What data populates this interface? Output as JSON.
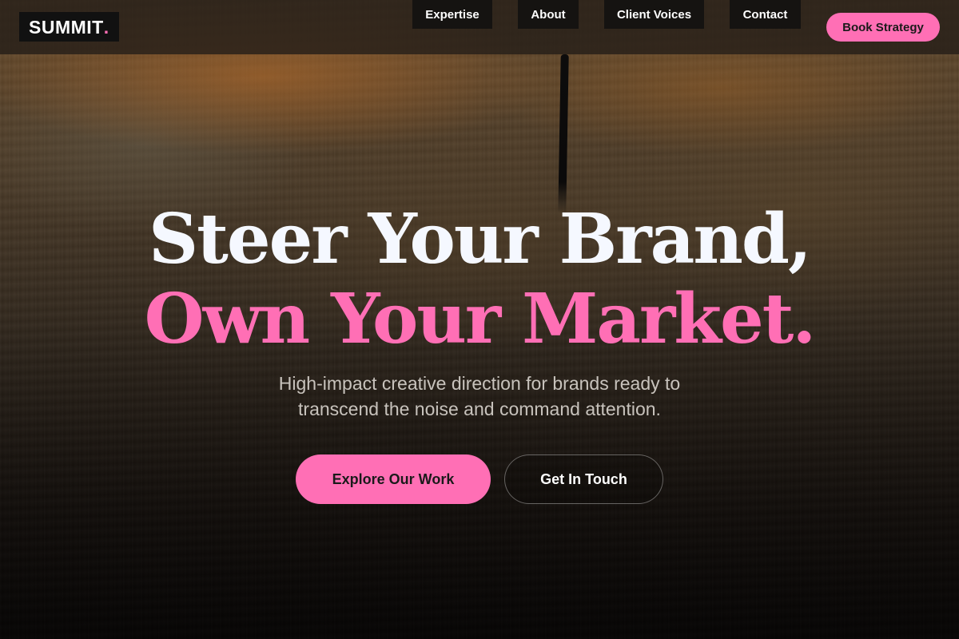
{
  "header": {
    "logo_text": "SUMMIT",
    "logo_dot": ".",
    "nav": [
      {
        "label": "Expertise"
      },
      {
        "label": "About"
      },
      {
        "label": "Client Voices"
      },
      {
        "label": "Contact"
      }
    ],
    "cta_label": "Book Strategy"
  },
  "hero": {
    "headline_line1": "Steer Your Brand,",
    "headline_line2": "Own Your Market.",
    "subtitle": "High-impact creative direction for brands ready to transcend the noise and command attention.",
    "primary_button": "Explore Our Work",
    "secondary_button": "Get In Touch"
  },
  "colors": {
    "accent": "#ff6fb5",
    "headline": "#f5f8ff",
    "nav_bg": "#151311"
  }
}
